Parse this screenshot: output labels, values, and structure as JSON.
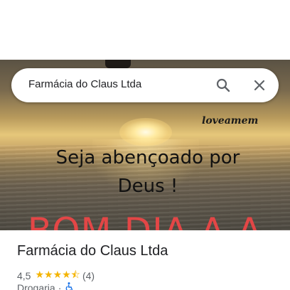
{
  "search": {
    "query": "Farmácia do Claus Ltda",
    "search_icon": "search-icon",
    "close_icon": "close-icon"
  },
  "photo": {
    "signature": "loveamem",
    "blessing": "Seja abençoado por Deus !",
    "greeting": "BOM DIA A A"
  },
  "place": {
    "name": "Farmácia do Claus Ltda",
    "rating": "4,5",
    "stars": "★★★★⯪",
    "review_count": "(4)",
    "category": "Drogaria",
    "separator": "·",
    "accessibility_icon": "wheelchair-icon"
  },
  "colors": {
    "greeting_red": "#e34646",
    "star_gold": "#f4b400",
    "accessibility_blue": "#1a73e8"
  }
}
